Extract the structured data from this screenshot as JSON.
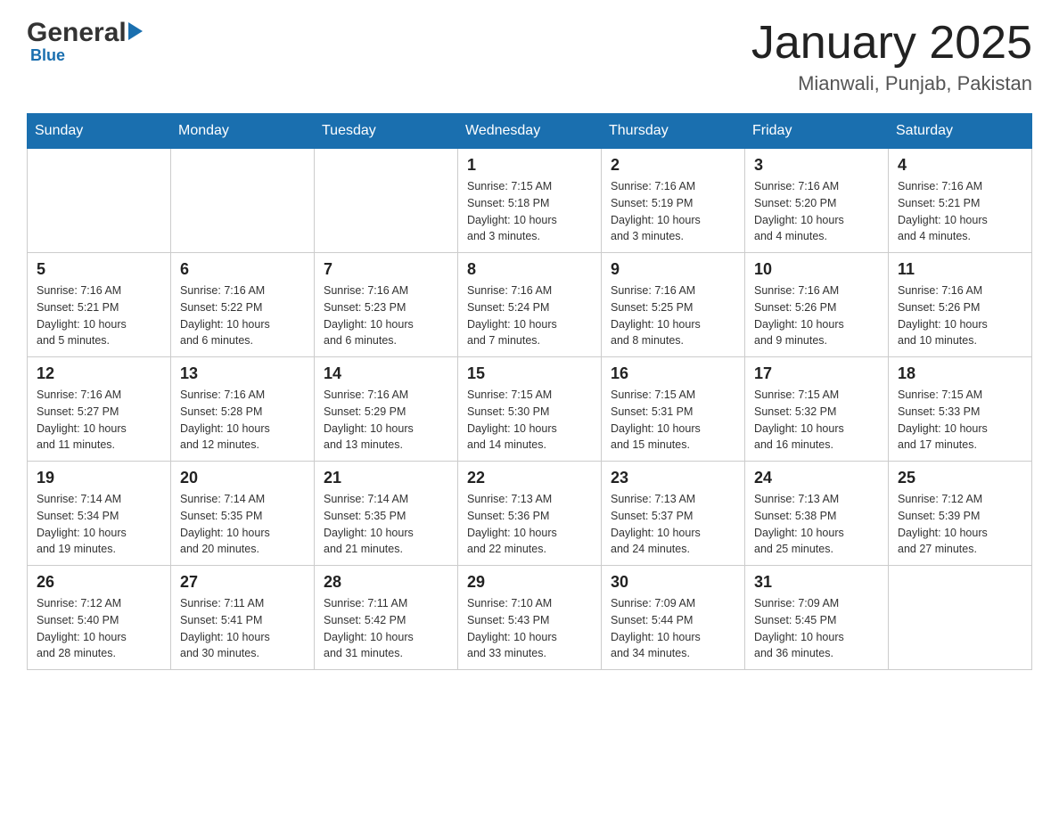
{
  "header": {
    "logo_general": "General",
    "logo_blue": "Blue",
    "month_title": "January 2025",
    "location": "Mianwali, Punjab, Pakistan"
  },
  "days_of_week": [
    "Sunday",
    "Monday",
    "Tuesday",
    "Wednesday",
    "Thursday",
    "Friday",
    "Saturday"
  ],
  "weeks": [
    [
      {
        "day": "",
        "info": ""
      },
      {
        "day": "",
        "info": ""
      },
      {
        "day": "",
        "info": ""
      },
      {
        "day": "1",
        "info": "Sunrise: 7:15 AM\nSunset: 5:18 PM\nDaylight: 10 hours\nand 3 minutes."
      },
      {
        "day": "2",
        "info": "Sunrise: 7:16 AM\nSunset: 5:19 PM\nDaylight: 10 hours\nand 3 minutes."
      },
      {
        "day": "3",
        "info": "Sunrise: 7:16 AM\nSunset: 5:20 PM\nDaylight: 10 hours\nand 4 minutes."
      },
      {
        "day": "4",
        "info": "Sunrise: 7:16 AM\nSunset: 5:21 PM\nDaylight: 10 hours\nand 4 minutes."
      }
    ],
    [
      {
        "day": "5",
        "info": "Sunrise: 7:16 AM\nSunset: 5:21 PM\nDaylight: 10 hours\nand 5 minutes."
      },
      {
        "day": "6",
        "info": "Sunrise: 7:16 AM\nSunset: 5:22 PM\nDaylight: 10 hours\nand 6 minutes."
      },
      {
        "day": "7",
        "info": "Sunrise: 7:16 AM\nSunset: 5:23 PM\nDaylight: 10 hours\nand 6 minutes."
      },
      {
        "day": "8",
        "info": "Sunrise: 7:16 AM\nSunset: 5:24 PM\nDaylight: 10 hours\nand 7 minutes."
      },
      {
        "day": "9",
        "info": "Sunrise: 7:16 AM\nSunset: 5:25 PM\nDaylight: 10 hours\nand 8 minutes."
      },
      {
        "day": "10",
        "info": "Sunrise: 7:16 AM\nSunset: 5:26 PM\nDaylight: 10 hours\nand 9 minutes."
      },
      {
        "day": "11",
        "info": "Sunrise: 7:16 AM\nSunset: 5:26 PM\nDaylight: 10 hours\nand 10 minutes."
      }
    ],
    [
      {
        "day": "12",
        "info": "Sunrise: 7:16 AM\nSunset: 5:27 PM\nDaylight: 10 hours\nand 11 minutes."
      },
      {
        "day": "13",
        "info": "Sunrise: 7:16 AM\nSunset: 5:28 PM\nDaylight: 10 hours\nand 12 minutes."
      },
      {
        "day": "14",
        "info": "Sunrise: 7:16 AM\nSunset: 5:29 PM\nDaylight: 10 hours\nand 13 minutes."
      },
      {
        "day": "15",
        "info": "Sunrise: 7:15 AM\nSunset: 5:30 PM\nDaylight: 10 hours\nand 14 minutes."
      },
      {
        "day": "16",
        "info": "Sunrise: 7:15 AM\nSunset: 5:31 PM\nDaylight: 10 hours\nand 15 minutes."
      },
      {
        "day": "17",
        "info": "Sunrise: 7:15 AM\nSunset: 5:32 PM\nDaylight: 10 hours\nand 16 minutes."
      },
      {
        "day": "18",
        "info": "Sunrise: 7:15 AM\nSunset: 5:33 PM\nDaylight: 10 hours\nand 17 minutes."
      }
    ],
    [
      {
        "day": "19",
        "info": "Sunrise: 7:14 AM\nSunset: 5:34 PM\nDaylight: 10 hours\nand 19 minutes."
      },
      {
        "day": "20",
        "info": "Sunrise: 7:14 AM\nSunset: 5:35 PM\nDaylight: 10 hours\nand 20 minutes."
      },
      {
        "day": "21",
        "info": "Sunrise: 7:14 AM\nSunset: 5:35 PM\nDaylight: 10 hours\nand 21 minutes."
      },
      {
        "day": "22",
        "info": "Sunrise: 7:13 AM\nSunset: 5:36 PM\nDaylight: 10 hours\nand 22 minutes."
      },
      {
        "day": "23",
        "info": "Sunrise: 7:13 AM\nSunset: 5:37 PM\nDaylight: 10 hours\nand 24 minutes."
      },
      {
        "day": "24",
        "info": "Sunrise: 7:13 AM\nSunset: 5:38 PM\nDaylight: 10 hours\nand 25 minutes."
      },
      {
        "day": "25",
        "info": "Sunrise: 7:12 AM\nSunset: 5:39 PM\nDaylight: 10 hours\nand 27 minutes."
      }
    ],
    [
      {
        "day": "26",
        "info": "Sunrise: 7:12 AM\nSunset: 5:40 PM\nDaylight: 10 hours\nand 28 minutes."
      },
      {
        "day": "27",
        "info": "Sunrise: 7:11 AM\nSunset: 5:41 PM\nDaylight: 10 hours\nand 30 minutes."
      },
      {
        "day": "28",
        "info": "Sunrise: 7:11 AM\nSunset: 5:42 PM\nDaylight: 10 hours\nand 31 minutes."
      },
      {
        "day": "29",
        "info": "Sunrise: 7:10 AM\nSunset: 5:43 PM\nDaylight: 10 hours\nand 33 minutes."
      },
      {
        "day": "30",
        "info": "Sunrise: 7:09 AM\nSunset: 5:44 PM\nDaylight: 10 hours\nand 34 minutes."
      },
      {
        "day": "31",
        "info": "Sunrise: 7:09 AM\nSunset: 5:45 PM\nDaylight: 10 hours\nand 36 minutes."
      },
      {
        "day": "",
        "info": ""
      }
    ]
  ]
}
